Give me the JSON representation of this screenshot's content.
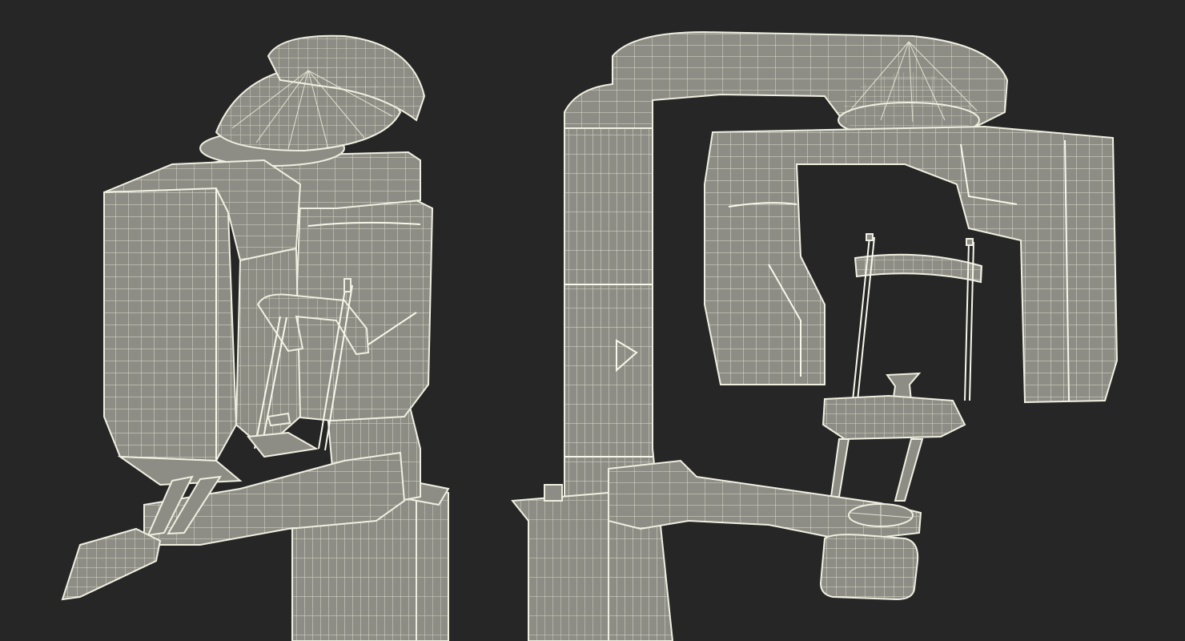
{
  "scene": {
    "background_color": "#262626",
    "model_color": "#8d8d85",
    "wire_color": "#efefe1",
    "views": [
      "dental-xray-unit-three-quarter-view",
      "dental-xray-unit-side-view"
    ]
  }
}
